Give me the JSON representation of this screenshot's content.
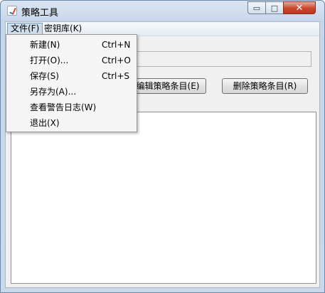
{
  "window": {
    "title": "策略工具",
    "minimize_symbol": "▭",
    "maximize_symbol": "□",
    "close_symbol": "✕"
  },
  "menubar": {
    "file_label": "文件(F)",
    "keystore_label": "密钥库(K)"
  },
  "file_menu": {
    "items": [
      {
        "label": "新建(N)",
        "shortcut": "Ctrl+N"
      },
      {
        "label": "打开(O)...",
        "shortcut": "Ctrl+O"
      },
      {
        "label": "保存(S)",
        "shortcut": "Ctrl+S"
      },
      {
        "label": "另存为(A)...",
        "shortcut": ""
      },
      {
        "label": "查看警告日志(W)",
        "shortcut": ""
      },
      {
        "label": "退出(X)",
        "shortcut": ""
      }
    ]
  },
  "toolbar": {
    "edit_label": "编辑策略条目(E)",
    "delete_label": "删除策略条目(R)"
  }
}
